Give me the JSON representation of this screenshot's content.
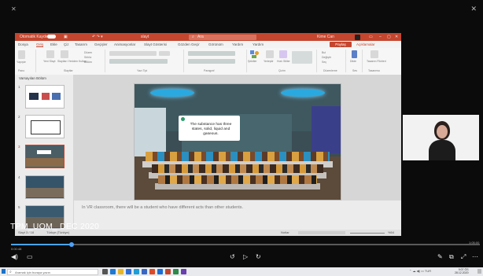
{
  "player": {
    "watermark": "TPM_UOM_ DEC 2020",
    "time_elapsed": "0:00:48",
    "time_total": "1:05:00",
    "progress_fraction": 0.13,
    "accent": "#4aa3ff"
  },
  "ppt": {
    "brand_color": "#c4462f",
    "autosave_label": "Otomatik Kaydet",
    "file_name": "slayt",
    "search_placeholder": "Ara",
    "user_name": "Kime Can",
    "tabs": [
      "Dosya",
      "Giriş",
      "Ekle",
      "Çiz",
      "Tasarım",
      "Geçişler",
      "Animasyonlar",
      "Slayt Gösterisi",
      "Gözden Geçir",
      "Görünüm",
      "Yardım",
      "Yardım"
    ],
    "active_tab": 1,
    "share_label": "Paylaş",
    "comments_label": "Açıklamalar",
    "ribbon_groups": [
      "Pano",
      "Slaytlar",
      "Yazı Tipi",
      "Paragraf",
      "Çizim",
      "Düzenleme",
      "Ses",
      "Tasarımcı"
    ],
    "ribbon_buttons": {
      "paste": "Yapıştır",
      "new_slide": "Yeni Slayt",
      "reuse_slides": "Slaytları Yeniden Kullan",
      "layout": "Düzen",
      "reset": "Sıfırla",
      "section": "Bölüm",
      "shapes": "Şekiller",
      "arrange": "Yerleştir",
      "quick_styles": "Hızlı Stiller",
      "find": "Bul",
      "replace": "Değiştir",
      "select": "Seç",
      "dictate": "Dikte",
      "design_ideas": "Tasarım Fikirleri"
    },
    "thumbs_header": "Varsayılan Bölüm",
    "slide_numbers": [
      "1",
      "2",
      "3",
      "4",
      "5"
    ],
    "selected_slide": 3,
    "slide": {
      "bubble_text": "The substance has three states, solid, liquid and gaseous."
    },
    "notes_text": "In VR classroom, there will be a student who have different acts than other students.",
    "status": {
      "slide_info": "Slayt 3 / 18",
      "language": "Türkçe (Türkiye)",
      "notes_label": "Notlar",
      "zoom": "%54"
    }
  },
  "taskbar": {
    "search_placeholder": "Aramak için buraya yazın",
    "time": "9:07 ÖS",
    "date": "28.12.2020"
  }
}
